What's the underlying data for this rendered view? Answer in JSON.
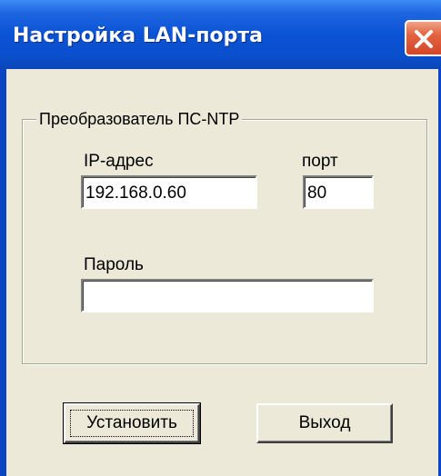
{
  "window": {
    "title": "Настройка LAN-порта"
  },
  "group": {
    "legend": "Преобразователь ПС-NTP"
  },
  "fields": {
    "ip_label": "IP-адрес",
    "ip_value": "192.168.0.60",
    "port_label": "порт",
    "port_value": "80",
    "password_label": "Пароль",
    "password_value": ""
  },
  "buttons": {
    "set_label": "Установить",
    "exit_label": "Выход"
  },
  "icons": {
    "close": "close-icon"
  },
  "colors": {
    "titlebar": "#0a53d6",
    "close_button": "#d4462a",
    "dialog_background": "#ece9d8"
  }
}
